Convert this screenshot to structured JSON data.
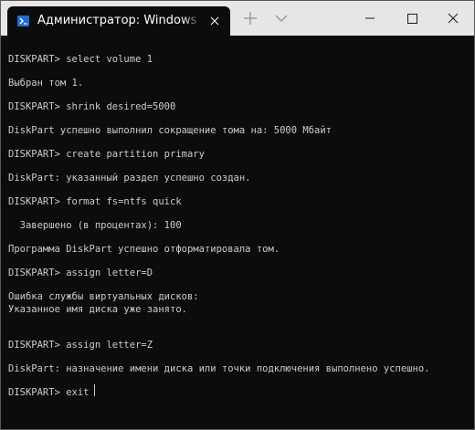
{
  "window": {
    "tab_title": "Администратор: Windows PowerShell",
    "icons": {
      "tab": "powershell-icon",
      "tab_close": "close-icon",
      "new_tab": "plus-icon",
      "dropdown": "chevron-down-icon",
      "minimize": "minimize-icon",
      "maximize": "maximize-icon",
      "close": "close-icon"
    },
    "colors": {
      "titlebar": "#e6e6e6",
      "terminal_bg": "#0c0c0c",
      "terminal_text": "#cccccc",
      "tab_icon": "#1f6fd1"
    }
  },
  "terminal": {
    "lines": [
      "DISKPART> select volume 1",
      "Выбран том 1.",
      "DISKPART> shrink desired=5000",
      "DiskPart успешно выполнил сокращение тома на: 5000 Мбайт",
      "DISKPART> create partition primary",
      "DiskPart: указанный раздел успешно создан.",
      "DISKPART> format fs=ntfs quick",
      "  Завершено (в процентах): 100",
      "Программа DiskPart успешно отформатировала том.",
      "DISKPART> assign letter=D",
      "Ошибка службы виртуальных дисков:",
      "Указанное имя диска уже занято.",
      "DISKPART> assign letter=Z",
      "DiskPart: назначение имени диска или точки подключения выполнено успешно.",
      "DISKPART> exit"
    ]
  }
}
